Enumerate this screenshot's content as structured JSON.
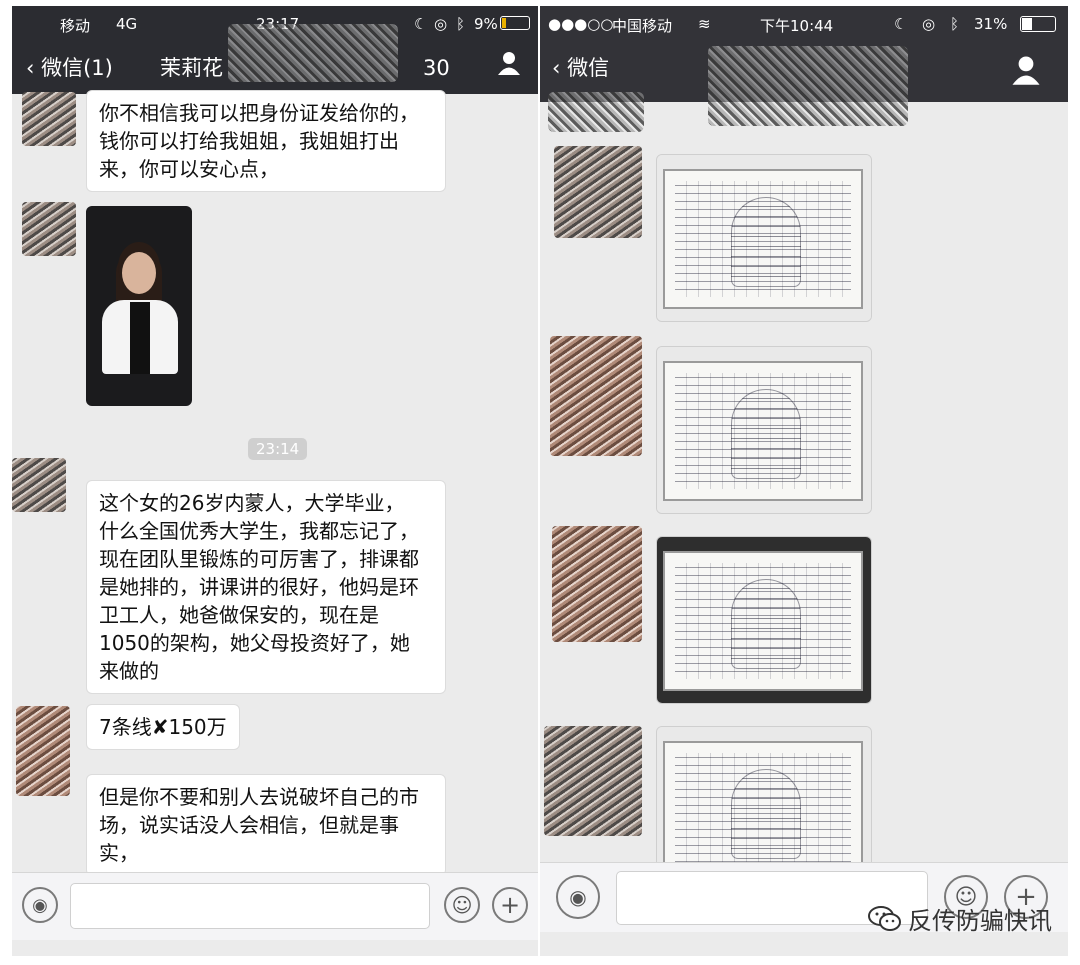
{
  "left_phone": {
    "status": {
      "carrier": "移动",
      "network": "4G",
      "time": "23:17",
      "battery": "9%"
    },
    "nav": {
      "back": "微信(1)",
      "title": "茉莉花",
      "title_suffix": "30"
    },
    "messages": [
      {
        "lines": [
          "你不相信我可以把身份证发给你的，",
          "钱你可以打给我姐姐，我姐姐打出",
          "来，你可以安心点，"
        ]
      },
      {
        "lines": [
          "这个女的26岁内蒙人，大学毕业，",
          "什么全国优秀大学生，我都忘记了，",
          "现在团队里锻炼的可厉害了，排课都",
          "是她排的，讲课讲的很好，他妈是环",
          "卫工人，她爸做保安的，现在是",
          "1050的架构，她父母投资好了，她",
          "来做的"
        ]
      },
      {
        "text": "7条线✘150万"
      },
      {
        "lines": [
          "但是你不要和别人去说破坏自己的市",
          "场，说实话没人会相信，但就是事",
          "实，"
        ]
      }
    ],
    "timestamp": "23:14"
  },
  "right_phone": {
    "status": {
      "signal": "●●●○○",
      "carrier": "中国移动",
      "time": "下午10:44",
      "battery": "31%"
    },
    "nav": {
      "back": "微信"
    }
  },
  "watermark": "反传防骗快讯",
  "icons": {
    "back": "chevron-left-icon",
    "contact": "person-icon",
    "voice": "voice-icon",
    "emoji": "smiley-icon",
    "add": "plus-icon",
    "wechat": "wechat-logo-icon"
  }
}
